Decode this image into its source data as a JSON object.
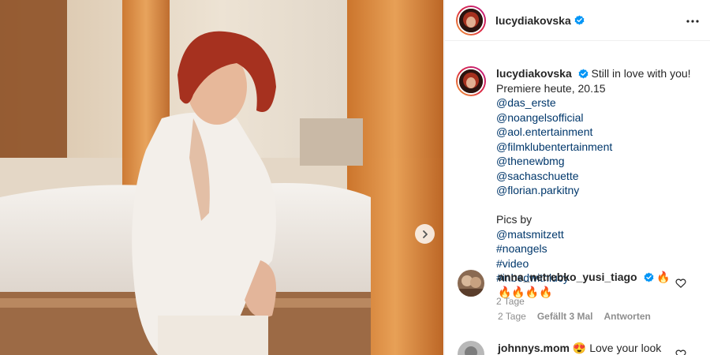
{
  "post": {
    "username": "lucydiakovska",
    "verified": true,
    "caption_first": "Still in love with you!",
    "caption_line2": "Premiere heute, 20.15",
    "mention_inline": "@das_erste",
    "mentions": [
      "@noangelsofficial",
      "@aol.entertainment",
      "@filmklubentertainment",
      "@thenewbmg",
      "@sachaschuette",
      "@florian.parkitny"
    ],
    "pics_by_prefix": "Pics by",
    "pics_by_mention": "@matsmitzett",
    "hashtags": [
      "#noangels",
      "#video",
      "#inbedwithlucy"
    ],
    "time_ago": "2 Tage"
  },
  "comments": [
    {
      "username": "anna_netrebko_yusi_tiago",
      "verified": true,
      "text": "🔥",
      "text_line2": "🔥🔥🔥🔥",
      "time_ago": "2 Tage",
      "likes": "Gefällt 3 Mal",
      "reply_label": "Antworten"
    },
    {
      "username": "johnnys.mom",
      "text": "😍 Love your look",
      "verified": false
    }
  ],
  "icons": {
    "verified": "verified-badge-icon",
    "more": "more-options-icon",
    "next": "chevron-right-icon",
    "like": "heart-icon"
  },
  "colors": {
    "link": "#00376b",
    "verified": "#0095f6",
    "meta": "#8e8e8e"
  }
}
